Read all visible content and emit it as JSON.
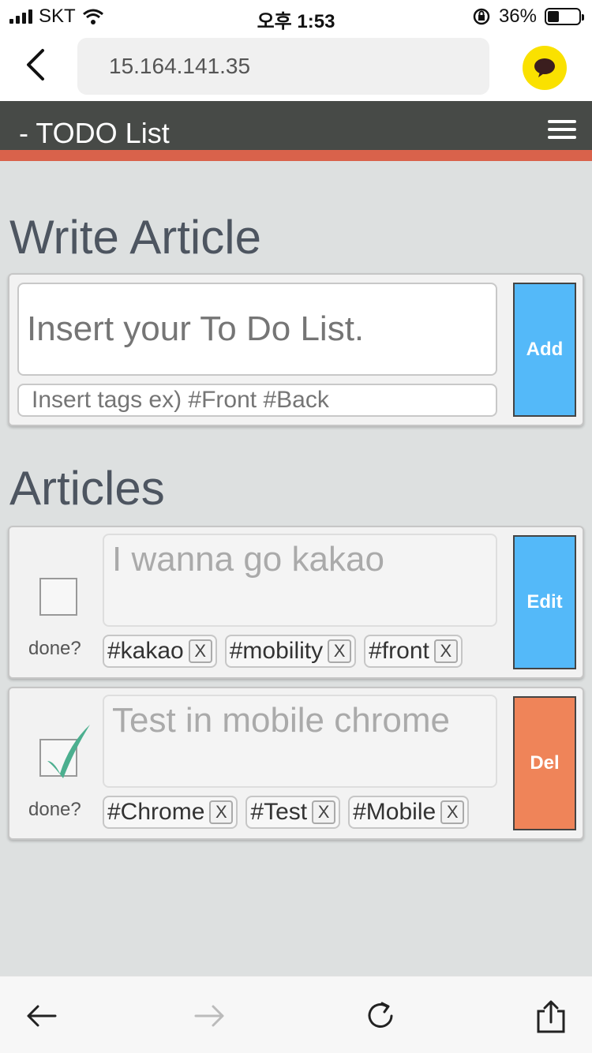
{
  "status": {
    "carrier": "SKT",
    "time": "오후 1:53",
    "battery": "36%",
    "battery_level": 0.36
  },
  "browser": {
    "url": "15.164.141.35"
  },
  "app": {
    "title": "- TODO List"
  },
  "write": {
    "heading": "Write Article",
    "todo_placeholder": "Insert your To Do List.",
    "tags_placeholder": "Insert tags ex) #Front #Back",
    "add_label": "Add"
  },
  "articles": {
    "heading": "Articles",
    "items": [
      {
        "text": "I wanna go kakao",
        "done": false,
        "done_label": "done?",
        "action_label": "Edit",
        "tags": [
          {
            "label": "#kakao",
            "remove": "X"
          },
          {
            "label": "#mobility",
            "remove": "X"
          },
          {
            "label": "#front",
            "remove": "X"
          }
        ]
      },
      {
        "text": "Test in mobile chrome",
        "done": true,
        "done_label": "done?",
        "action_label": "Del",
        "tags": [
          {
            "label": "#Chrome",
            "remove": "X"
          },
          {
            "label": "#Test",
            "remove": "X"
          },
          {
            "label": "#Mobile",
            "remove": "X"
          }
        ]
      }
    ]
  },
  "colors": {
    "header": "#474a47",
    "accent": "#d9624b",
    "edit": "#54b9f9",
    "delete": "#ef8459",
    "check": "#4caf8f"
  }
}
